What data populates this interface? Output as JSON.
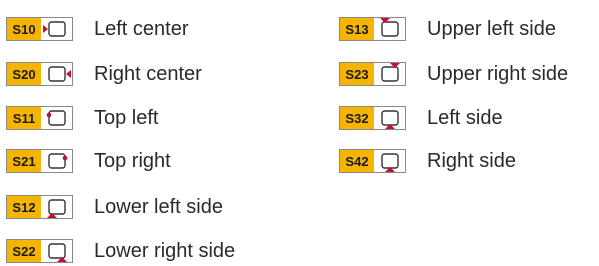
{
  "colors": {
    "code_fill": "#F5B400",
    "marker": "#C4102F",
    "outline": "#333333"
  },
  "items": [
    {
      "code": "S10",
      "label": "Left center",
      "marker": "left-center"
    },
    {
      "code": "S20",
      "label": "Right center",
      "marker": "right-center"
    },
    {
      "code": "S11",
      "label": "Top left",
      "marker": "top-left"
    },
    {
      "code": "S21",
      "label": "Top right",
      "marker": "top-right"
    },
    {
      "code": "S12",
      "label": "Lower left side",
      "marker": "lower-left-side"
    },
    {
      "code": "S22",
      "label": "Lower right side",
      "marker": "lower-right-side"
    },
    {
      "code": "S13",
      "label": "Upper left side",
      "marker": "upper-left-side"
    },
    {
      "code": "S23",
      "label": "Upper right side",
      "marker": "upper-right-side"
    },
    {
      "code": "S32",
      "label": "Left side",
      "marker": "left-side"
    },
    {
      "code": "S42",
      "label": "Right side",
      "marker": "right-side"
    }
  ]
}
